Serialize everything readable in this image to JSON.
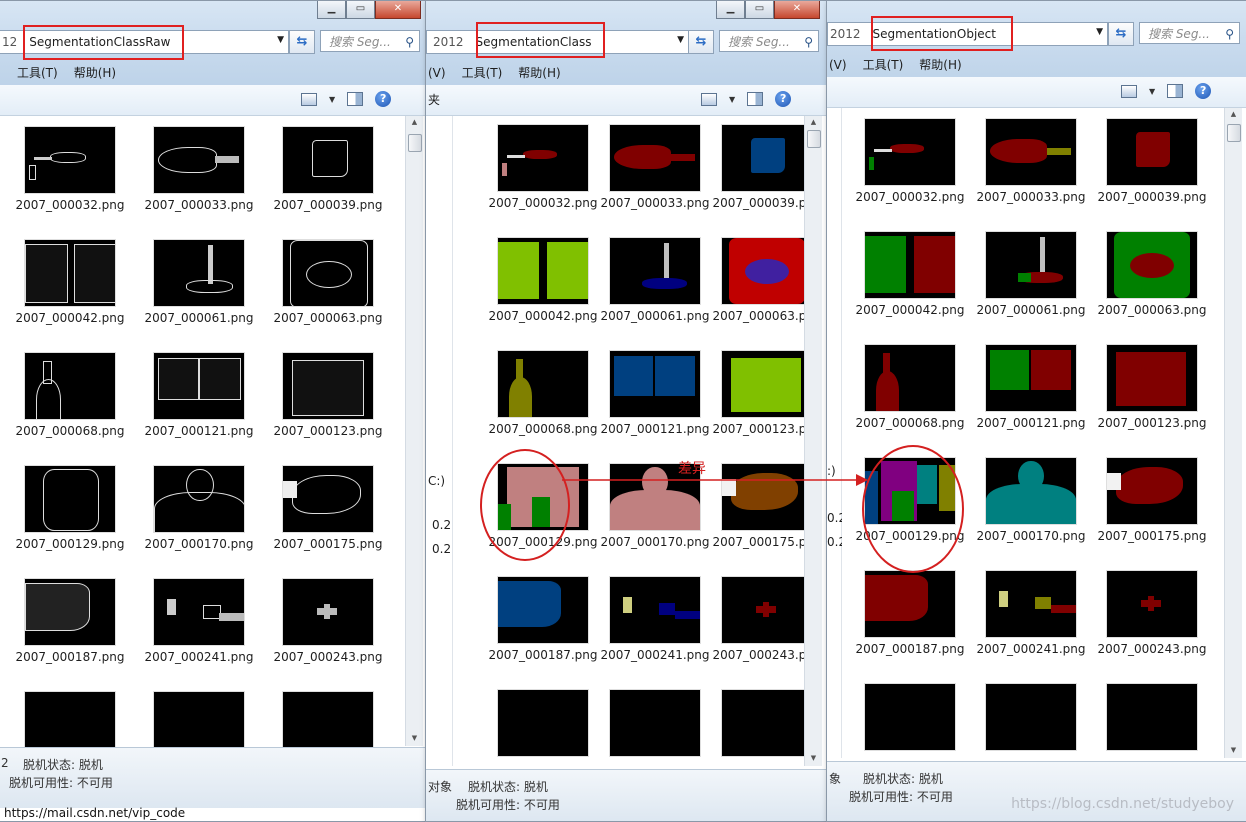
{
  "win1": {
    "address_prefix": "12",
    "crumb": "SegmentationClassRaw",
    "search_placeholder": "搜索 Seg...",
    "menu": [
      "",
      "工具(T)",
      "帮助(H)"
    ],
    "status_line1_prefix": "2",
    "status_line1": "脱机状态: 脱机",
    "status_line2": "脱机可用性: 不可用"
  },
  "win2": {
    "address_prefix": "2012",
    "crumb": "SegmentationClass",
    "search_placeholder": "搜索 Seg...",
    "menu": [
      "(V)",
      "工具(T)",
      "帮助(H)"
    ],
    "nav_items": [
      "夹",
      "C:)",
      "0.2",
      "0.2"
    ],
    "status_prefix": "对象",
    "status_line1": "脱机状态: 脱机",
    "status_line2": "脱机可用性: 不可用"
  },
  "win3": {
    "address_prefix": "2012",
    "crumb": "SegmentationObject",
    "search_placeholder": "搜索 Seg...",
    "menu": [
      "(V)",
      "工具(T)",
      "帮助(H)"
    ],
    "nav_items": [
      ":)",
      "0.2",
      "0.2"
    ],
    "status_prefix": "象",
    "status_line1": "脱机状态: 脱机",
    "status_line2": "脱机可用性: 不可用"
  },
  "files": [
    "2007_000032.png",
    "2007_000033.png",
    "2007_000039.png",
    "2007_000042.png",
    "2007_000061.png",
    "2007_000063.png",
    "2007_000068.png",
    "2007_000121.png",
    "2007_000123.png",
    "2007_000129.png",
    "2007_000170.png",
    "2007_000175.png",
    "2007_000187.png",
    "2007_000241.png",
    "2007_000243.png"
  ],
  "annotation": {
    "label": "差异",
    "color": "#d42020"
  },
  "taskbar_url": "https://mail.csdn.net/vip_code",
  "watermark": "https://blog.csdn.net/studyeboy",
  "colors": {
    "aeroplane": "#800000",
    "bus": "#008080",
    "bird": "#808000",
    "person": "#c08080",
    "bicycle": "#008000",
    "motorbike": "#404080",
    "boat": "#000080",
    "bottle": "#800080",
    "dog": "#804000",
    "chair": "#c00000",
    "pottedplant": "#80c000",
    "tvmonitor": "#004080",
    "sofa": "#00409f"
  }
}
